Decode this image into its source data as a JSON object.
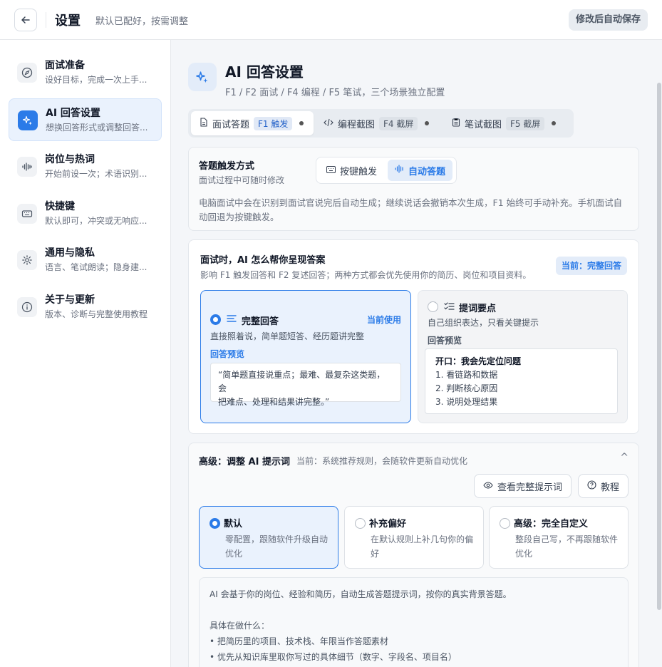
{
  "header": {
    "title": "设置",
    "subtitle": "默认已配好，按需调整",
    "autosave_label": "修改后自动保存"
  },
  "sidebar": {
    "items": [
      {
        "title": "面试准备",
        "desc": "设好目标，完成一次上手..."
      },
      {
        "title": "AI 回答设置",
        "desc": "想换回答形式或调整回答..."
      },
      {
        "title": "岗位与热词",
        "desc": "开始前设一次；术语识别..."
      },
      {
        "title": "快捷键",
        "desc": "默认即可，冲突或无响应..."
      },
      {
        "title": "通用与隐私",
        "desc": "语言、笔试朗读；隐身建..."
      },
      {
        "title": "关于与更新",
        "desc": "版本、诊断与完整使用教程"
      }
    ]
  },
  "page": {
    "title": "AI 回答设置",
    "subtitle": "F1 / F2 面试 / F4 编程 / F5 笔试，三个场景独立配置"
  },
  "tabs": [
    {
      "label": "面试答题",
      "key": "F1 触发"
    },
    {
      "label": "编程截图",
      "key": "F4 截屏"
    },
    {
      "label": "笔试截图",
      "key": "F5 截屏"
    }
  ],
  "trigger": {
    "title": "答题触发方式",
    "desc": "面试过程中可随时修改",
    "options": [
      "按键触发",
      "自动答题"
    ],
    "note_line1": "电脑面试中会在识别到面试官说完后自动生成；继续说话会撤销本次生成，F1 始终可手动补充。手机面试自",
    "note_line2": "动回退为按键触发。"
  },
  "presentation": {
    "title": "面试时，AI 怎么帮你呈现答案",
    "desc": "影响 F1 触发回答和 F2 复述回答；两种方式都会优先使用你的简历、岗位和项目资料。",
    "badge": "当前：完整回答",
    "full": {
      "title": "完整回答",
      "current": "当前使用",
      "desc": "直接照着说，简单题短答、经历题讲完整",
      "preview_label": "回答预览",
      "preview_line1": "“简单题直接说重点；最难、最复杂这类题，会",
      "preview_line2": "把难点、处理和结果讲完整。”"
    },
    "keypoints": {
      "title": "提词要点",
      "desc": "自己组织表达，只看关键提示",
      "preview_label": "回答预览",
      "opener": "开口：我会先定位问题",
      "points": [
        "1. 看链路和数据",
        "2. 判断核心原因",
        "3. 说明处理结果"
      ]
    }
  },
  "advanced": {
    "title": "高级：调整 AI 提示词",
    "current": "当前：系统推荐规则，会随软件更新自动优化",
    "collapse": "^",
    "view_button": "查看完整提示词",
    "tutorial_button": "教程",
    "options": [
      {
        "title": "默认",
        "desc": "零配置，跟随软件升级自动优化"
      },
      {
        "title": "补充偏好",
        "desc": "在默认规则上补几句你的偏好"
      },
      {
        "title": "高级：完全自定义",
        "desc": "整段自己写，不再跟随软件优化"
      }
    ],
    "info_intro": "AI 会基于你的岗位、经验和简历，自动生成答题提示词，按你的真实背景答题。",
    "info_heading": "具体在做什么：",
    "info_bullets": [
      "• 把简历里的项目、技术栈、年限当作答题素材",
      "• 优先从知识库里取你写过的具体细节（数字、字段名、项目名）"
    ]
  },
  "colors": {
    "accent": "#2b7be8",
    "accent_bg": "#eaf2fd"
  }
}
